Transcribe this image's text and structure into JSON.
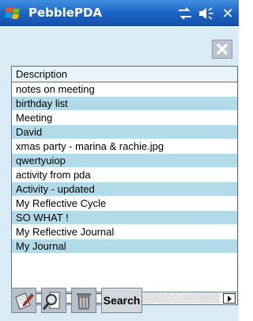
{
  "titlebar": {
    "app_title": "PebblePDA",
    "icons": [
      "windows-logo-icon",
      "connectivity-icon",
      "speaker-icon",
      "close-icon"
    ],
    "close_glyph": "✕"
  },
  "list": {
    "header": "Description",
    "items": [
      "notes on meeting",
      "birthday list",
      "Meeting",
      "David",
      "xmas party - marina & rachie.jpg",
      "qwertyuiop",
      "activity from pda",
      "Activity - updated",
      "My Reflective Cycle",
      "SO WHAT !",
      "My Reflective Journal",
      "My Journal"
    ]
  },
  "scrollbar": {
    "thumb_glyph": "|||",
    "left_arrow": "◀",
    "right_arrow": "▶"
  },
  "toolbar": {
    "buttons": [
      "new-note-icon",
      "find-icon",
      "delete-icon"
    ],
    "search_label": "Search"
  },
  "colors": {
    "titlebar": "#1a62c4",
    "background": "#d9ecf5",
    "row_alt": "#b1dbe8"
  }
}
